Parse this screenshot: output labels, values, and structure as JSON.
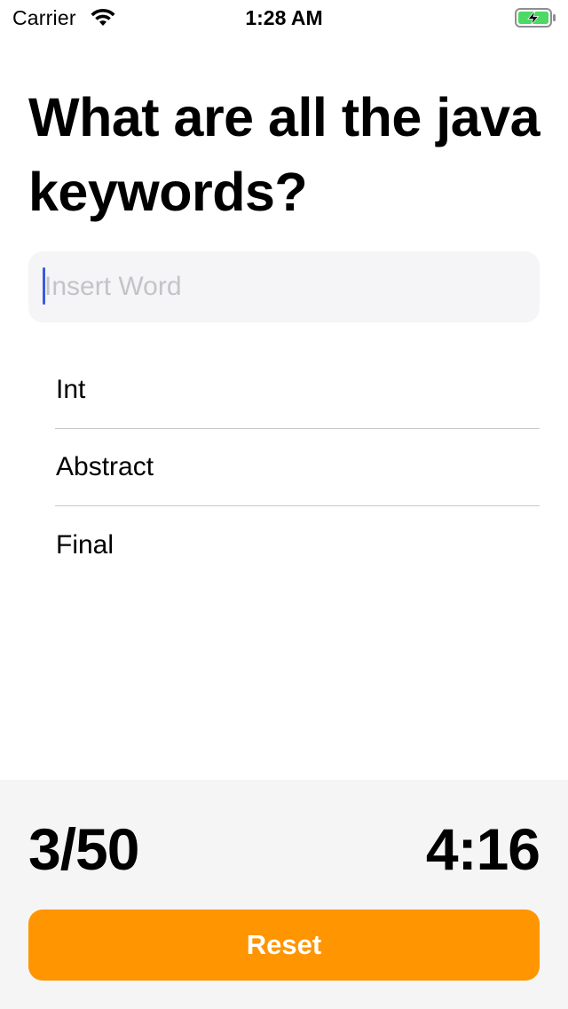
{
  "status_bar": {
    "carrier": "Carrier",
    "time": "1:28 AM",
    "wifi_icon": "wifi-icon",
    "battery_icon": "battery-charging-icon",
    "battery_color": "#4cd964"
  },
  "question": {
    "title": "What are all the java keywords?"
  },
  "input": {
    "placeholder": "Insert Word",
    "value": ""
  },
  "words": [
    {
      "label": "Int"
    },
    {
      "label": "Abstract"
    },
    {
      "label": "Final"
    }
  ],
  "footer": {
    "score": "3/50",
    "timer": "4:16",
    "reset_label": "Reset",
    "accent_color": "#ff9500"
  }
}
